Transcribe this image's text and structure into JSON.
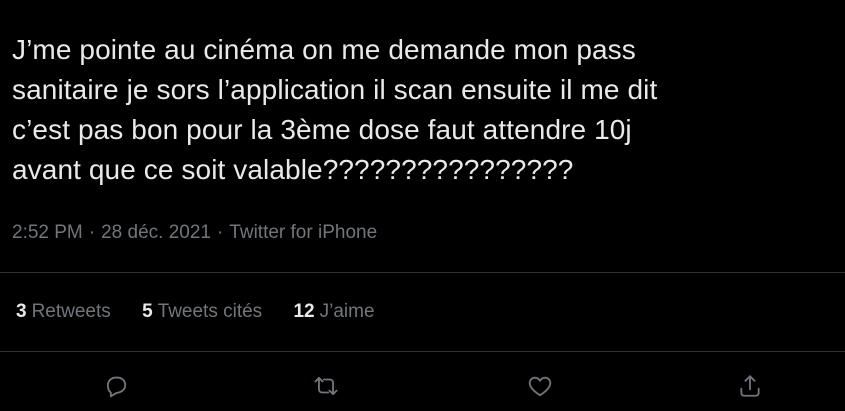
{
  "tweet": {
    "text": "J’me pointe au cinéma on me demande mon pass\nsanitaire je sors l’application il scan ensuite il me dit\nc’est pas bon pour la 3ème dose faut attendre 10j\navant que ce soit valable????????????????"
  },
  "meta": {
    "time": "2:52 PM",
    "date": "28 déc. 2021",
    "source": "Twitter for iPhone",
    "separator": "·"
  },
  "stats": {
    "retweets": {
      "count": "3",
      "label": "Retweets"
    },
    "quotes": {
      "count": "5",
      "label": "Tweets cités"
    },
    "likes": {
      "count": "12",
      "label": "J’aime"
    }
  },
  "actions": {
    "reply_icon": "reply-icon",
    "retweet_icon": "retweet-icon",
    "like_icon": "heart-icon",
    "share_icon": "share-icon"
  },
  "colors": {
    "background": "#000000",
    "text": "#e7e9ea",
    "secondary": "#71767b",
    "divider": "#2f3336"
  }
}
